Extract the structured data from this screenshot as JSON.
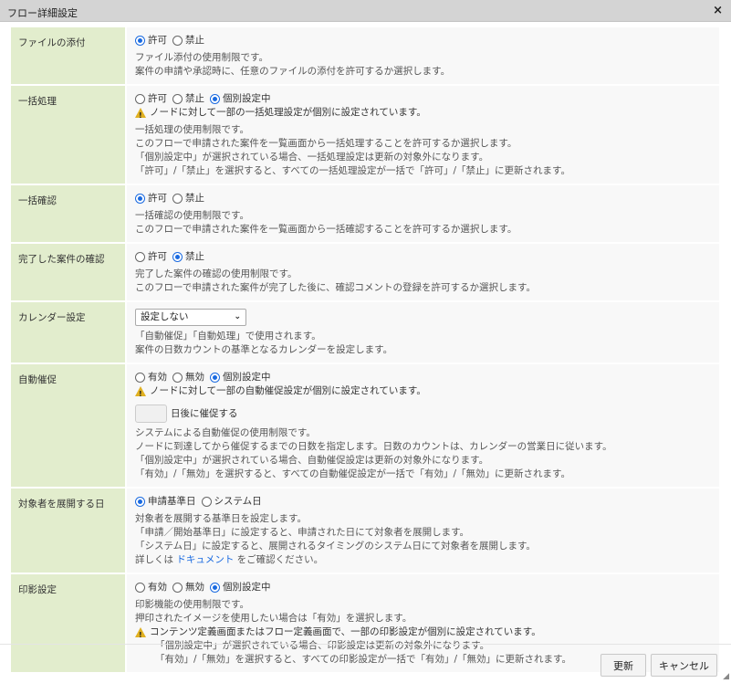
{
  "dialog": {
    "title": "フロー詳細設定",
    "close_icon": "×"
  },
  "rows": [
    {
      "label": "ファイルの添付",
      "options": [
        "許可",
        "禁止"
      ],
      "selected": 0,
      "desc": [
        "ファイル添付の使用制限です。",
        "案件の申請や承認時に、任意のファイルの添付を許可するか選択します。"
      ]
    },
    {
      "label": "一括処理",
      "options": [
        "許可",
        "禁止",
        "個別設定中"
      ],
      "selected": 2,
      "warning": "ノードに対して一部の一括処理設定が個別に設定されています。",
      "desc": [
        "一括処理の使用制限です。",
        "このフローで申請された案件を一覧画面から一括処理することを許可するか選択します。",
        "「個別設定中」が選択されている場合、一括処理設定は更新の対象外になります。",
        "「許可」/「禁止」を選択すると、すべての一括処理設定が一括で「許可」/「禁止」に更新されます。"
      ]
    },
    {
      "label": "一括確認",
      "options": [
        "許可",
        "禁止"
      ],
      "selected": 0,
      "desc": [
        "一括確認の使用制限です。",
        "このフローで申請された案件を一覧画面から一括確認することを許可するか選択します。"
      ]
    },
    {
      "label": "完了した案件の確認",
      "options": [
        "許可",
        "禁止"
      ],
      "selected": 1,
      "desc": [
        "完了した案件の確認の使用制限です。",
        "このフローで申請された案件が完了した後に、確認コメントの登録を許可するか選択します。"
      ]
    },
    {
      "label": "カレンダー設定",
      "select_value": "設定しない",
      "desc": [
        "「自動催促」「自動処理」で使用されます。",
        "案件の日数カウントの基準となるカレンダーを設定します。"
      ]
    },
    {
      "label": "自動催促",
      "options": [
        "有効",
        "無効",
        "個別設定中"
      ],
      "selected": 2,
      "warning": "ノードに対して一部の自動催促設定が個別に設定されています。",
      "days_input": "",
      "days_suffix": "日後に催促する",
      "desc": [
        "システムによる自動催促の使用制限です。",
        "ノードに到達してから催促するまでの日数を指定します。日数のカウントは、カレンダーの営業日に従います。",
        "「個別設定中」が選択されている場合、自動催促設定は更新の対象外になります。",
        "「有効」/「無効」を選択すると、すべての自動催促設定が一括で「有効」/「無効」に更新されます。"
      ]
    },
    {
      "label": "対象者を展開する日",
      "options": [
        "申請基準日",
        "システム日"
      ],
      "selected": 0,
      "desc": [
        "対象者を展開する基準日を設定します。",
        "「申請／開始基準日」に設定すると、申請された日にて対象者を展開します。",
        "「システム日」に設定すると、展開されるタイミングのシステム日にて対象者を展開します。"
      ],
      "link_prefix": "詳しくは ",
      "link_text": "ドキュメント",
      "link_suffix": " をご確認ください。"
    },
    {
      "label": "印影設定",
      "options": [
        "有効",
        "無効",
        "個別設定中"
      ],
      "selected": 2,
      "desc": [
        "印影機能の使用制限です。",
        "押印されたイメージを使用したい場合は「有効」を選択します。"
      ],
      "warning": "コンテンツ定義画面またはフロー定義画面で、一部の印影設定が個別に設定されています。",
      "warning_desc": [
        "「個別設定中」が選択されている場合、印影設定は更新の対象外になります。",
        "「有効」/「無効」を選択すると、すべての印影設定が一括で「有効」/「無効」に更新されます。"
      ]
    }
  ],
  "footer": {
    "update": "更新",
    "cancel": "キャンセル"
  }
}
